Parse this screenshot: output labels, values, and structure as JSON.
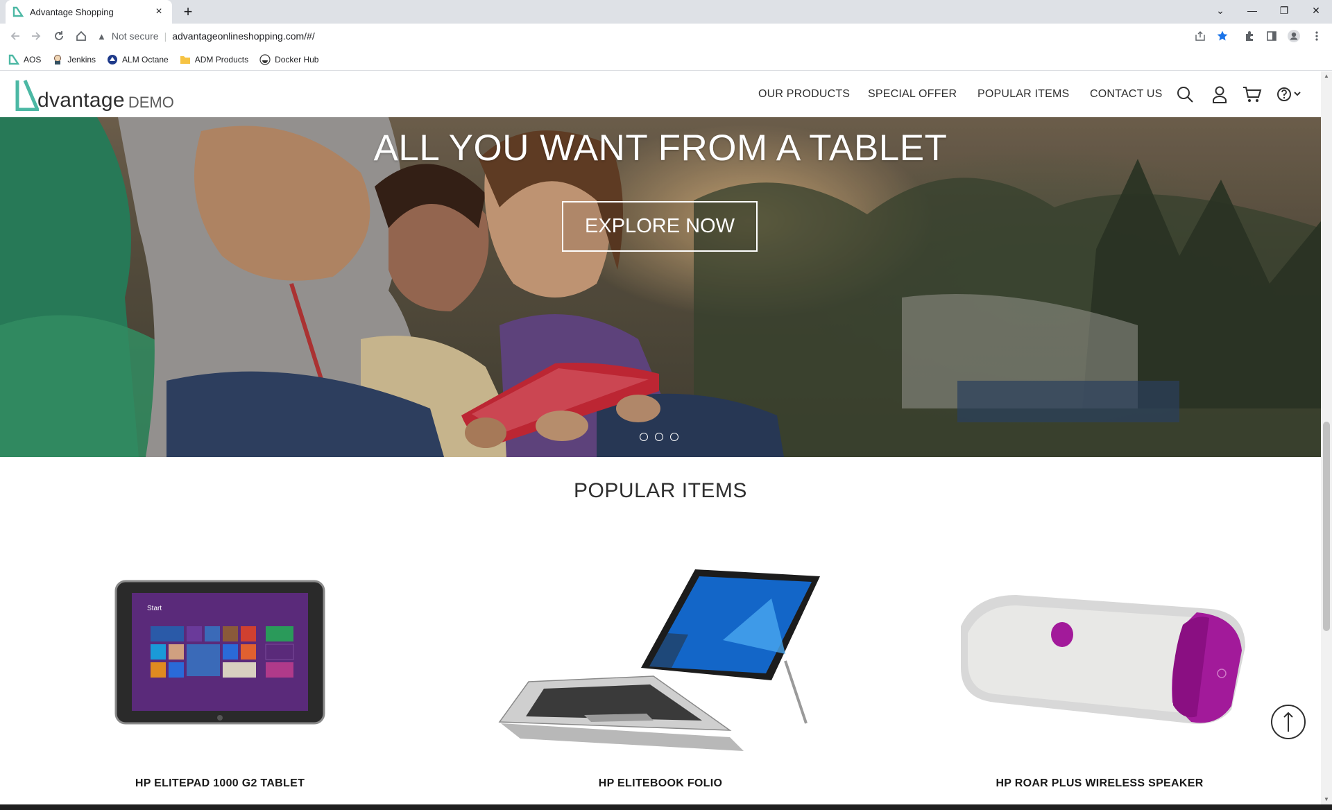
{
  "browser": {
    "tab_title": "Advantage Shopping",
    "close_glyph": "×",
    "new_tab_glyph": "+",
    "security_label": "Not secure",
    "url": "advantageonlineshopping.com/#/",
    "window_controls": [
      "⌄",
      "—",
      "❐",
      "✕"
    ],
    "bookmarks": [
      {
        "label": "AOS",
        "icon": "aos-logo-icon"
      },
      {
        "label": "Jenkins",
        "icon": "jenkins-icon"
      },
      {
        "label": "ALM Octane",
        "icon": "octane-icon"
      },
      {
        "label": "ADM Products",
        "icon": "folder-icon"
      },
      {
        "label": "Docker Hub",
        "icon": "docker-icon"
      }
    ]
  },
  "site": {
    "logo_text": "dvantage",
    "logo_suffix": "DEMO",
    "nav": [
      "OUR PRODUCTS",
      "SPECIAL OFFER",
      "POPULAR ITEMS",
      "CONTACT US"
    ],
    "accent_color": "#4cb8a4"
  },
  "hero": {
    "title": "ALL YOU WANT FROM A TABLET",
    "cta": "EXPLORE NOW",
    "slides": 3
  },
  "popular": {
    "title": "POPULAR ITEMS",
    "items": [
      {
        "name": "HP ELITEPAD 1000 G2 TABLET"
      },
      {
        "name": "HP ELITEBOOK FOLIO"
      },
      {
        "name": "HP ROAR PLUS WIRELESS SPEAKER"
      }
    ]
  }
}
